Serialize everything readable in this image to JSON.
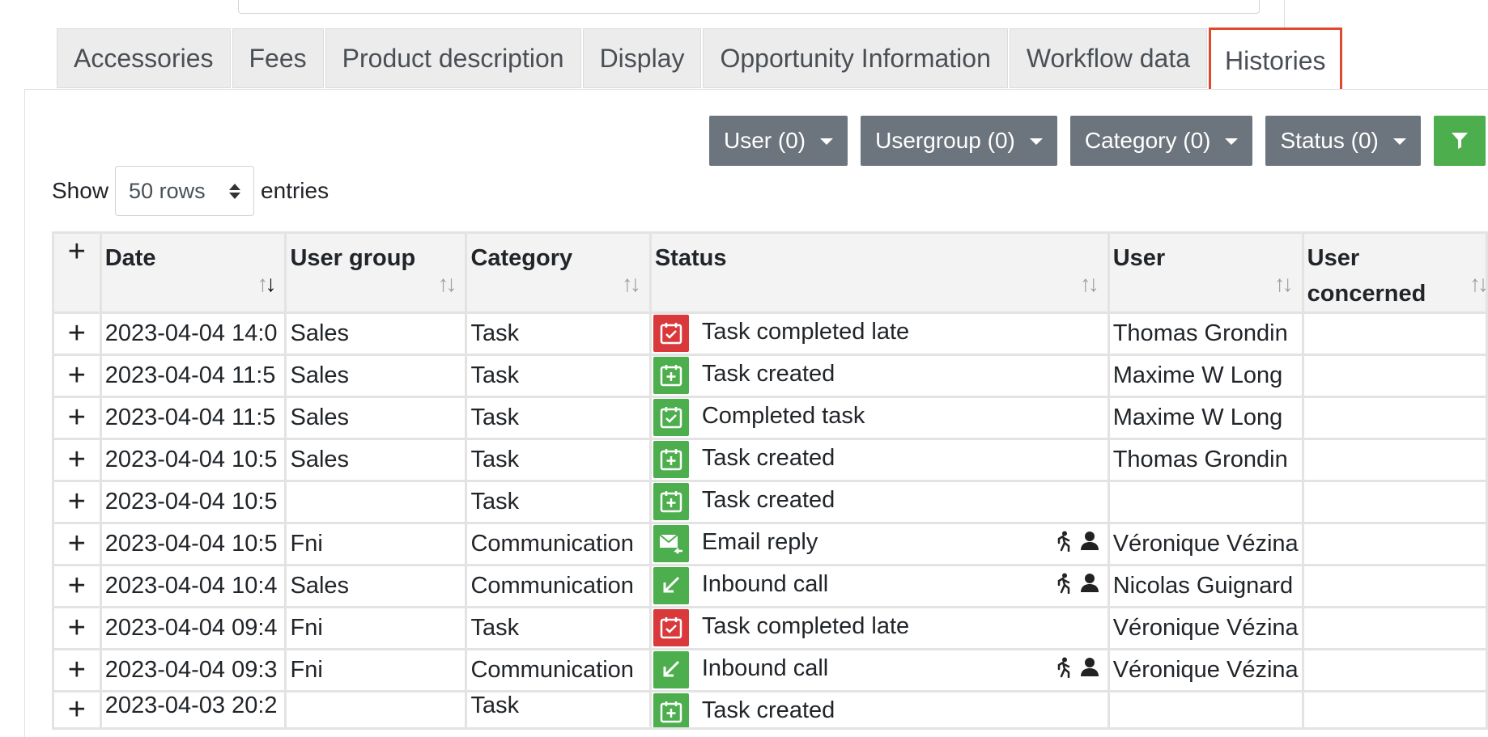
{
  "tabs": [
    {
      "label": "Accessories",
      "active": false
    },
    {
      "label": "Fees",
      "active": false
    },
    {
      "label": "Product description",
      "active": false
    },
    {
      "label": "Display",
      "active": false
    },
    {
      "label": "Opportunity Information",
      "active": false
    },
    {
      "label": "Workflow data",
      "active": false
    },
    {
      "label": "Histories",
      "active": true
    }
  ],
  "filters": {
    "user": "User (0)",
    "usergroup": "Usergroup (0)",
    "category": "Category (0)",
    "status": "Status (0)",
    "apply_icon": "filter-icon"
  },
  "length": {
    "prefix": "Show",
    "selected": "50 rows",
    "suffix": "entries"
  },
  "table": {
    "expand_all": "+",
    "columns": [
      "Date",
      "User group",
      "Category",
      "Status",
      "User",
      "User concerned"
    ],
    "rows": [
      {
        "date": "2023-04-04 14:0",
        "group": "Sales",
        "category": "Task",
        "status": "Task completed late",
        "icon": "calendar-check-icon",
        "color": "#d9393b",
        "extra": false,
        "user": "Thomas Grondin",
        "concerned": ""
      },
      {
        "date": "2023-04-04 11:5",
        "group": "Sales",
        "category": "Task",
        "status": "Task created",
        "icon": "calendar-plus-icon",
        "color": "#4cae4c",
        "extra": false,
        "user": "Maxime W Long",
        "concerned": ""
      },
      {
        "date": "2023-04-04 11:5",
        "group": "Sales",
        "category": "Task",
        "status": "Completed task",
        "icon": "calendar-check-icon",
        "color": "#4cae4c",
        "extra": false,
        "user": "Maxime W Long",
        "concerned": ""
      },
      {
        "date": "2023-04-04 10:5",
        "group": "Sales",
        "category": "Task",
        "status": "Task created",
        "icon": "calendar-plus-icon",
        "color": "#4cae4c",
        "extra": false,
        "user": "Thomas Grondin",
        "concerned": ""
      },
      {
        "date": "2023-04-04 10:5",
        "group": "",
        "category": "Task",
        "status": "Task created",
        "icon": "calendar-plus-icon",
        "color": "#4cae4c",
        "extra": false,
        "user": "",
        "concerned": ""
      },
      {
        "date": "2023-04-04 10:5",
        "group": "Fni",
        "category": "Communication",
        "status": "Email reply",
        "icon": "email-reply-icon",
        "color": "#4cae4c",
        "extra": true,
        "user": "Véronique Vézina",
        "concerned": ""
      },
      {
        "date": "2023-04-04 10:4",
        "group": "Sales",
        "category": "Communication",
        "status": "Inbound call",
        "icon": "inbound-call-icon",
        "color": "#4cae4c",
        "extra": true,
        "user": "Nicolas Guignard",
        "concerned": ""
      },
      {
        "date": "2023-04-04 09:4",
        "group": "Fni",
        "category": "Task",
        "status": "Task completed late",
        "icon": "calendar-check-icon",
        "color": "#d9393b",
        "extra": false,
        "user": "Véronique Vézina",
        "concerned": ""
      },
      {
        "date": "2023-04-04 09:3",
        "group": "Fni",
        "category": "Communication",
        "status": "Inbound call",
        "icon": "inbound-call-icon",
        "color": "#4cae4c",
        "extra": true,
        "user": "Véronique Vézina",
        "concerned": ""
      },
      {
        "date": "2023-04-03 20:2",
        "group": "",
        "category": "Task",
        "status": "Task created",
        "icon": "calendar-plus-icon",
        "color": "#4cae4c",
        "extra": false,
        "user": "",
        "concerned": ""
      }
    ]
  }
}
